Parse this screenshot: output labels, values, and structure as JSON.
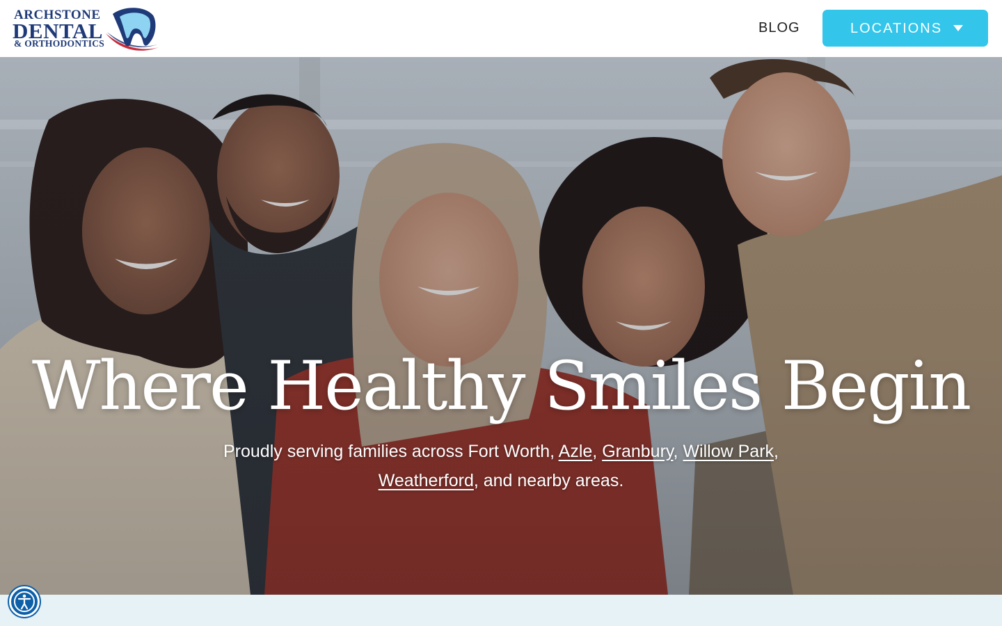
{
  "brand": {
    "logo_line1": "ARCHSTONE",
    "logo_line2": "DENTAL",
    "logo_line3": "& ORTHODONTICS",
    "primary_color": "#1f3a78",
    "accent_color": "#c62b3b"
  },
  "nav": {
    "blog_label": "BLOG",
    "locations_label": "LOCATIONS",
    "locations_icon": "chevron-down-icon",
    "button_color": "#33c5ea"
  },
  "hero": {
    "title": "Where Healthy Smiles Begin",
    "subtitle_prefix": "Proudly serving families across Fort Worth, ",
    "links": [
      "Azle",
      "Granbury",
      "Willow Park",
      "Weatherford"
    ],
    "subtitle_suffix": ", and nearby areas."
  },
  "accessibility": {
    "icon": "accessibility-icon",
    "color": "#0d5fa8"
  },
  "band_color": "#e6f2f6"
}
